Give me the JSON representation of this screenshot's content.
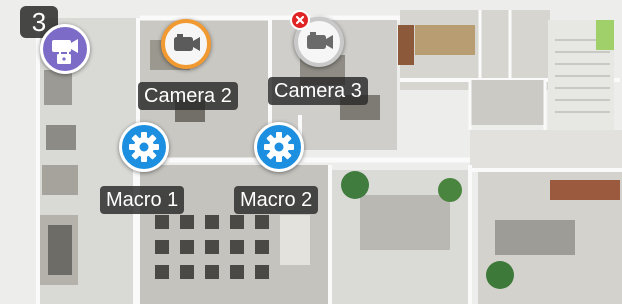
{
  "floor": {
    "number": "3"
  },
  "cameras": [
    {
      "label": "Camera 2",
      "icon": "video-camera-icon",
      "ring_color": "#f29a32",
      "status": "active"
    },
    {
      "label": "Camera 3",
      "icon": "video-camera-icon",
      "ring_color": "#c9c9c9",
      "status": "error"
    }
  ],
  "security_camera": {
    "icon": "camera-lock-icon",
    "color": "#7d6cc7"
  },
  "macros": [
    {
      "label": "Macro 1",
      "icon": "gear-icon",
      "color": "#1d8fe0"
    },
    {
      "label": "Macro 2",
      "icon": "gear-icon",
      "color": "#1d8fe0"
    }
  ]
}
